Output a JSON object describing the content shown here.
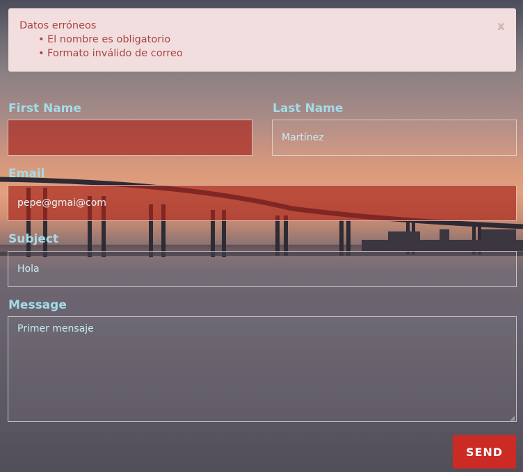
{
  "alert": {
    "title": "Datos erróneos",
    "errors": [
      "El nombre es obligatorio",
      "Formato inválido de correo"
    ],
    "close_label": "x"
  },
  "form": {
    "first_name": {
      "label": "First Name",
      "value": ""
    },
    "last_name": {
      "label": "Last Name",
      "value": "Martínez"
    },
    "email": {
      "label": "Email",
      "value": "pepe@gmai@com"
    },
    "subject": {
      "label": "Subject",
      "value": "Hola"
    },
    "message": {
      "label": "Message",
      "value": "Primer mensaje"
    },
    "send_label": "SEND"
  },
  "colors": {
    "alert_bg": "#f2dede",
    "alert_text": "#a94442",
    "label": "#a4dbe8",
    "error_field": "#a8261e",
    "send_button": "#cb2a25"
  }
}
